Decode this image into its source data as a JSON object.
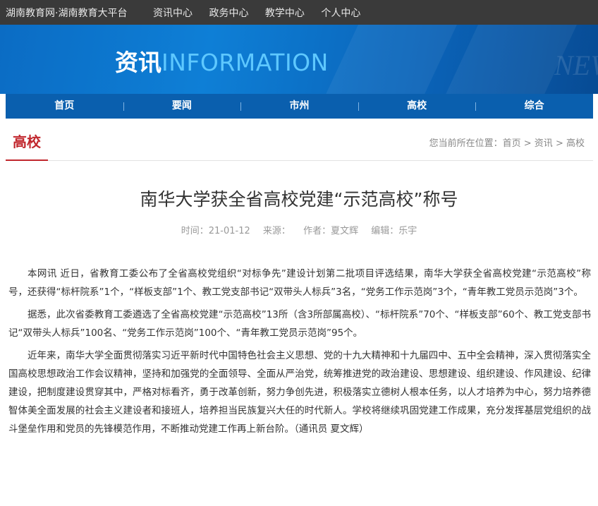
{
  "topbar": {
    "site_name": "湖南教育网·湖南教育大平台",
    "links": [
      "资讯中心",
      "政务中心",
      "教学中心",
      "个人中心"
    ]
  },
  "banner": {
    "title_zh": "资讯",
    "title_en": "INFORMATION",
    "deco": "NEW"
  },
  "main_nav": [
    "首页",
    "要闻",
    "市州",
    "高校",
    "综合"
  ],
  "section": {
    "label": "高校",
    "breadcrumb_prefix": "您当前所在位置：",
    "breadcrumb": [
      "首页",
      "资讯",
      "高校"
    ],
    "separator": " > "
  },
  "article": {
    "title": "南华大学获全省高校党建“示范高校”称号",
    "meta": {
      "time": "时间：21-01-12",
      "source": "来源：",
      "author": "作者：夏文辉",
      "editor": "编辑：乐宇"
    },
    "paragraphs": [
      "本网讯 近日，省教育工委公布了全省高校党组织“对标争先”建设计划第二批项目评选结果，南华大学获全省高校党建“示范高校”称号，还获得“标杆院系”1个，“样板支部”1个、教工党支部书记“双带头人标兵”3名，“党务工作示范岗”3个，“青年教工党员示范岗”3个。",
      "据悉，此次省委教育工委遴选了全省高校党建“示范高校”13所（含3所部属高校）、“标杆院系”70个、“样板支部”60个、教工党支部书记“双带头人标兵”100名、“党务工作示范岗”100个、“青年教工党员示范岗”95个。",
      "近年来，南华大学全面贯彻落实习近平新时代中国特色社会主义思想、党的十九大精神和十九届四中、五中全会精神，深入贯彻落实全国高校思想政治工作会议精神，坚持和加强党的全面领导、全面从严治党，统筹推进党的政治建设、思想建设、组织建设、作风建设、纪律建设，把制度建设贯穿其中，严格对标看齐，勇于改革创新，努力争创先进，积极落实立德树人根本任务，以人才培养为中心，努力培养德智体美全面发展的社会主义建设者和接班人，培养担当民族复兴大任的时代新人。学校将继续巩固党建工作成果，充分发挥基层党组织的战斗堡垒作用和党员的先锋模范作用，不断推动党建工作再上新台阶。（通讯员 夏文辉）"
    ]
  },
  "colors": {
    "topbar_bg": "#3a3a3a",
    "nav_bg": "#0a5fae",
    "accent_red": "#c1272d",
    "title_en": "#5ec8ff"
  }
}
